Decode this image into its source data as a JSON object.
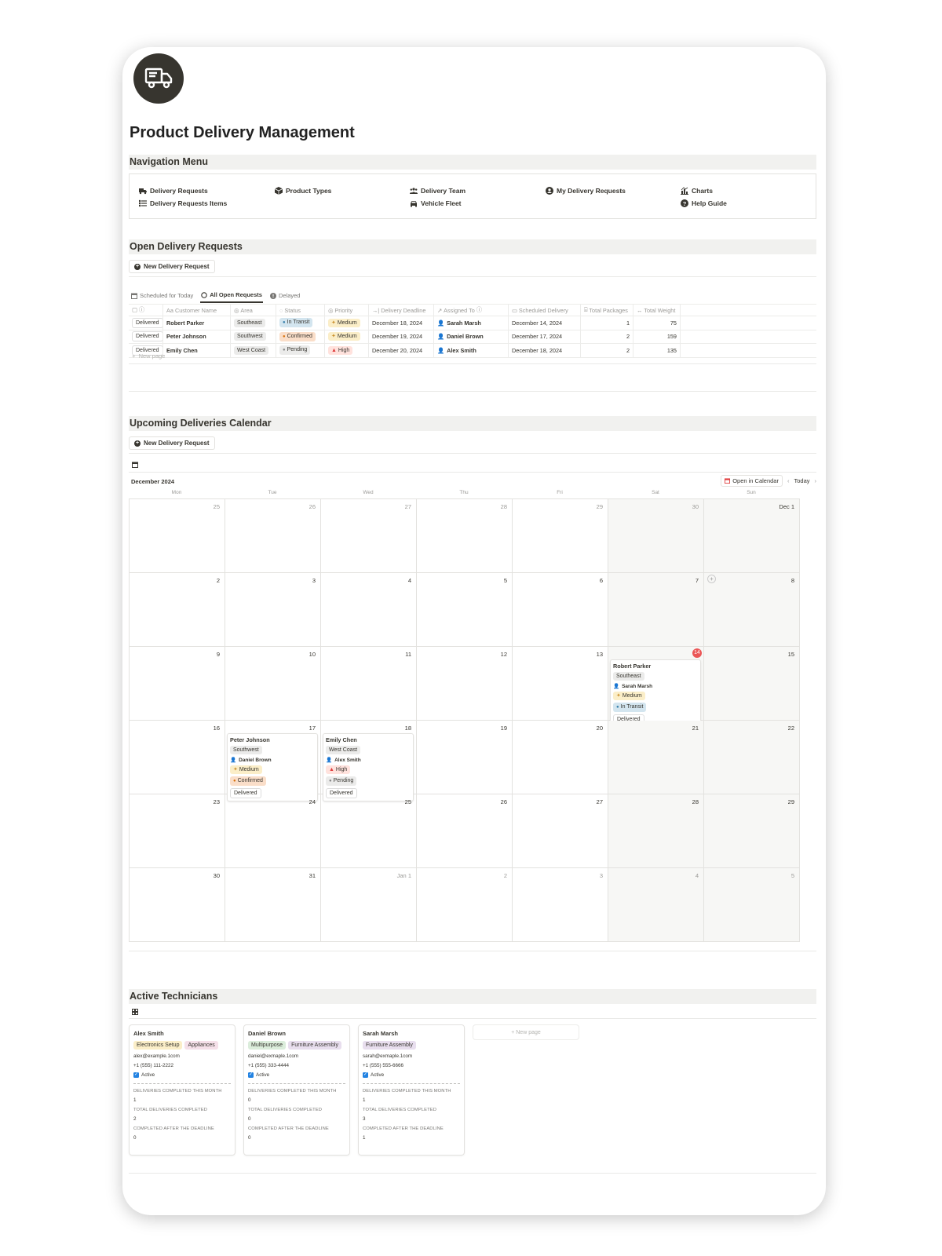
{
  "page": {
    "title": "Product Delivery Management",
    "logo_icon": "truck-icon"
  },
  "navigation": {
    "title": "Navigation Menu",
    "items": [
      {
        "label": "Delivery Requests",
        "icon": "truck-icon"
      },
      {
        "label": "Delivery Requests Items",
        "icon": "list-icon"
      },
      {
        "label": "Product Types",
        "icon": "box-icon"
      },
      {
        "label": "Delivery Team",
        "icon": "team-icon"
      },
      {
        "label": "Vehicle Fleet",
        "icon": "car-icon"
      },
      {
        "label": "My Delivery Requests",
        "icon": "user-circle-icon"
      },
      {
        "label": "Charts",
        "icon": "chart-icon"
      },
      {
        "label": "Help Guide",
        "icon": "help-icon"
      }
    ]
  },
  "open_requests": {
    "title": "Open Delivery Requests",
    "new_button": "New Delivery Request",
    "tabs": [
      "Scheduled for Today",
      "All Open Requests",
      "Delayed"
    ],
    "columns": [
      "",
      "Customer Name",
      "Area",
      "Status",
      "Priority",
      "Delivery Deadline",
      "Assigned To",
      "Scheduled Delivery",
      "Total Packages",
      "Total Weight"
    ],
    "rows": [
      {
        "button": "Delivered",
        "customer": "Robert Parker",
        "area": "Southeast",
        "status": "In Transit",
        "priority": "Medium",
        "deadline": "December 18, 2024",
        "assigned": "Sarah Marsh",
        "scheduled": "December 14, 2024",
        "packages": "1",
        "weight": "75"
      },
      {
        "button": "Delivered",
        "customer": "Peter Johnson",
        "area": "Southwest",
        "status": "Confirmed",
        "priority": "Medium",
        "deadline": "December 19, 2024",
        "assigned": "Daniel Brown",
        "scheduled": "December 17, 2024",
        "packages": "2",
        "weight": "159"
      },
      {
        "button": "Delivered",
        "customer": "Emily Chen",
        "area": "West Coast",
        "status": "Pending",
        "priority": "High",
        "deadline": "December 20, 2024",
        "assigned": "Alex Smith",
        "scheduled": "December 18, 2024",
        "packages": "2",
        "weight": "135"
      }
    ],
    "new_page": "New page"
  },
  "calendar": {
    "title": "Upcoming Deliveries Calendar",
    "new_button": "New Delivery Request",
    "month": "December 2024",
    "open_in_calendar": "Open in Calendar",
    "today_label": "Today",
    "weekdays": [
      "Mon",
      "Tue",
      "Wed",
      "Thu",
      "Fri",
      "Sat",
      "Sun"
    ],
    "days": [
      "25",
      "26",
      "27",
      "28",
      "29",
      "30",
      "Dec 1",
      "2",
      "3",
      "4",
      "5",
      "6",
      "7",
      "8",
      "9",
      "10",
      "11",
      "12",
      "13",
      "14",
      "15",
      "16",
      "17",
      "18",
      "19",
      "20",
      "21",
      "22",
      "23",
      "24",
      "25",
      "26",
      "27",
      "28",
      "29",
      "30",
      "31",
      "Jan 1",
      "2",
      "3",
      "4",
      "5"
    ],
    "events": [
      {
        "day_index": 19,
        "name": "Robert Parker",
        "area": "Southeast",
        "assigned": "Sarah Marsh",
        "priority": "Medium",
        "status": "In Transit",
        "button": "Delivered"
      },
      {
        "day_index": 22,
        "name": "Peter Johnson",
        "area": "Southwest",
        "assigned": "Daniel Brown",
        "priority": "Medium",
        "status": "Confirmed",
        "button": "Delivered"
      },
      {
        "day_index": 23,
        "name": "Emily Chen",
        "area": "West Coast",
        "assigned": "Alex Smith",
        "priority": "High",
        "status": "Pending",
        "button": "Delivered"
      }
    ]
  },
  "technicians": {
    "title": "Active Technicians",
    "cards": [
      {
        "name": "Alex Smith",
        "tags": [
          "Electronics Setup",
          "Appliances"
        ],
        "email": "alex@example.1com",
        "phone": "+1 (555) 111-2222",
        "active": "Active",
        "l1": "DELIVERIES COMPLETED THIS MONTH",
        "v1": "1",
        "l2": "TOTAL DELIVERIES COMPLETED",
        "v2": "2",
        "l3": "COMPLETED AFTER THE DEADLINE",
        "v3": "0"
      },
      {
        "name": "Daniel Brown",
        "tags": [
          "Multipurpose",
          "Furniture Assembly"
        ],
        "email": "daniel@exmaple.1com",
        "phone": "+1 (555) 333-4444",
        "active": "Active",
        "l1": "DELIVERIES COMPLETED THIS MONTH",
        "v1": "0",
        "l2": "TOTAL DELIVERIES COMPLETED",
        "v2": "0",
        "l3": "COMPLETED AFTER THE DEADLINE",
        "v3": "0"
      },
      {
        "name": "Sarah Marsh",
        "tags": [
          "Furniture Assembly"
        ],
        "email": "sarah@exmaple.1com",
        "phone": "+1 (555) 555-6666",
        "active": "Active",
        "l1": "DELIVERIES COMPLETED THIS MONTH",
        "v1": "1",
        "l2": "TOTAL DELIVERIES COMPLETED",
        "v2": "3",
        "l3": "COMPLETED AFTER THE DEADLINE",
        "v3": "1"
      }
    ],
    "new_page": "New page"
  },
  "colors": {
    "accent_blue": "#2383e2",
    "today_red": "#eb5757",
    "logo_bg": "#37352f"
  }
}
